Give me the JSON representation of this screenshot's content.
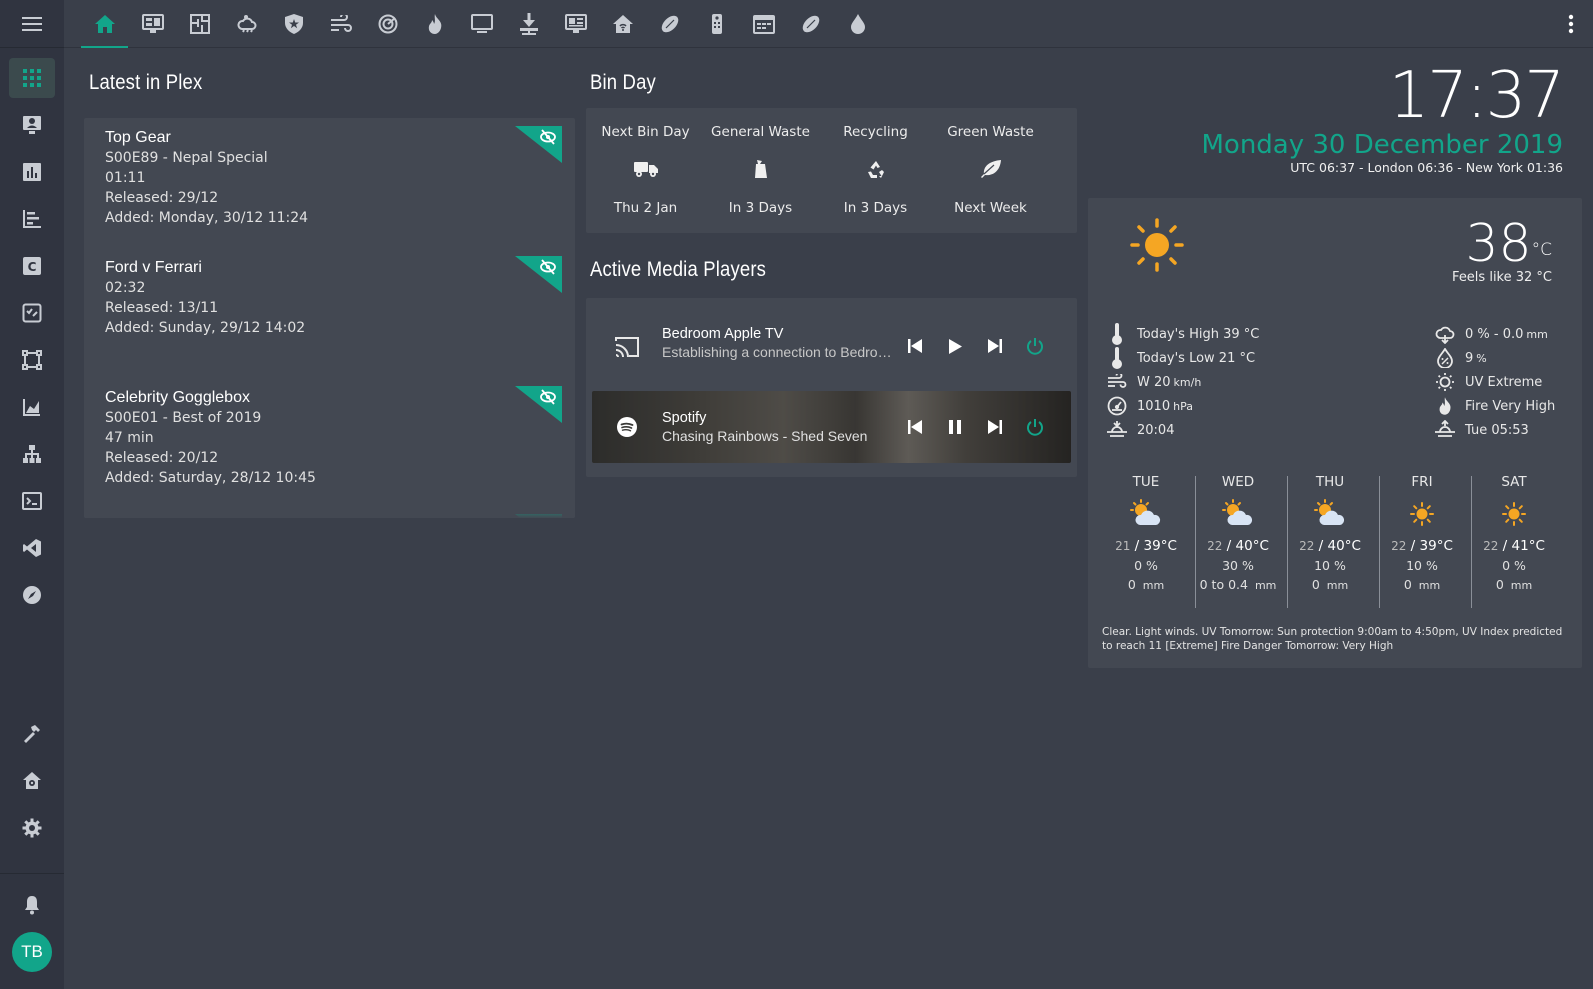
{
  "colors": {
    "accent": "#12a58a",
    "background": "#3a3f4a",
    "card": "#434852",
    "sidebar": "#303440",
    "sun": "#f5a623"
  },
  "sidebar": {
    "menu_icon": "hamburger-menu-icon",
    "items": [
      "grid-icon",
      "contact-card-icon",
      "bar-chart-icon",
      "gantt-icon",
      "c-box-icon",
      "checklist-icon",
      "vector-square-icon",
      "area-chart-icon",
      "network-icon",
      "terminal-icon",
      "vscode-icon",
      "compass-icon"
    ],
    "bottom_items": [
      "hammer-icon",
      "home-gear-icon",
      "settings-icon"
    ],
    "notification_icon": "bell-icon",
    "avatar_initials": "TB"
  },
  "topbar": {
    "tabs": [
      "home",
      "monitor-dashboard",
      "floor-plan",
      "weather-cloud",
      "shield",
      "wind",
      "radar",
      "fire",
      "television",
      "download",
      "newspaper",
      "home-automation",
      "rugby-ball",
      "remote",
      "calendar",
      "rugby-ball-2",
      "water-drop"
    ],
    "active_tab": "home",
    "more_icon": "dots-vertical-icon"
  },
  "plex": {
    "header": "Latest in Plex",
    "items": [
      {
        "title": "Top Gear",
        "lines": [
          "S00E89 - Nepal Special",
          "01:11",
          "Released: 29/12",
          "Added: Monday, 30/12 11:24"
        ]
      },
      {
        "title": "Ford v Ferrari",
        "lines": [
          "02:32",
          "Released: 13/11",
          "Added: Sunday, 29/12 14:02"
        ]
      },
      {
        "title": "Celebrity Gogglebox",
        "lines": [
          "S00E01 - Best of 2019",
          "47 min",
          "Released: 20/12",
          "Added: Saturday, 28/12 10:45"
        ]
      }
    ]
  },
  "bin_day": {
    "header": "Bin Day",
    "columns": [
      {
        "label": "Next Bin Day",
        "icon": "truck-icon",
        "value": "Thu 2 Jan"
      },
      {
        "label": "General Waste",
        "icon": "trash-bag-icon",
        "value": "In 3 Days"
      },
      {
        "label": "Recycling",
        "icon": "recycle-icon",
        "value": "In 3 Days"
      },
      {
        "label": "Green Waste",
        "icon": "leaf-icon",
        "value": "Next Week"
      }
    ]
  },
  "media": {
    "header": "Active Media Players",
    "players": [
      {
        "name": "Bedroom Apple TV",
        "status": "Establishing a connection to Bedroom Apple TV",
        "icon": "cast-icon",
        "state": "paused"
      },
      {
        "name": "Spotify",
        "status": "Chasing Rainbows - Shed Seven",
        "icon": "spotify-icon",
        "state": "playing"
      }
    ]
  },
  "clock": {
    "time": "17:37",
    "date": "Monday 30 December 2019",
    "timezones": "UTC 06:37 - London 06:36 - New York 01:36"
  },
  "weather": {
    "current_icon": "sunny-icon",
    "temperature": "38",
    "temperature_unit": "°C",
    "feels_like": "Feels like 32 °C",
    "left": [
      {
        "icon": "thermometer-high-icon",
        "text": "Today's High 39 °C",
        "unit": ""
      },
      {
        "icon": "thermometer-low-icon",
        "text": "Today's Low 21 °C",
        "unit": ""
      },
      {
        "icon": "wind-icon",
        "text": "W 20",
        "unit": "km/h"
      },
      {
        "icon": "gauge-icon",
        "text": "1010",
        "unit": "hPa"
      },
      {
        "icon": "sunset-icon",
        "text": "20:04",
        "unit": ""
      }
    ],
    "right": [
      {
        "icon": "rain-cloud-icon",
        "text": "0 % - 0.0",
        "unit": "mm"
      },
      {
        "icon": "humidity-icon",
        "text": "9",
        "unit": "%"
      },
      {
        "icon": "uv-icon",
        "text": "UV Extreme",
        "unit": ""
      },
      {
        "icon": "fire-icon",
        "text": "Fire Very High",
        "unit": ""
      },
      {
        "icon": "sunrise-icon",
        "text": "Tue 05:53",
        "unit": ""
      }
    ],
    "forecast": [
      {
        "day": "TUE",
        "icon": "partly-cloudy-icon",
        "low": "21",
        "high": "39°C",
        "rain_chance": "0 %",
        "rain_amount": "0",
        "rain_unit": "mm"
      },
      {
        "day": "WED",
        "icon": "partly-cloudy-icon",
        "low": "22",
        "high": "40°C",
        "rain_chance": "30 %",
        "rain_amount": "0 to 0.4",
        "rain_unit": "mm"
      },
      {
        "day": "THU",
        "icon": "partly-cloudy-icon",
        "low": "22",
        "high": "40°C",
        "rain_chance": "10 %",
        "rain_amount": "0",
        "rain_unit": "mm"
      },
      {
        "day": "FRI",
        "icon": "sunny-icon",
        "low": "22",
        "high": "39°C",
        "rain_chance": "10 %",
        "rain_amount": "0",
        "rain_unit": "mm"
      },
      {
        "day": "SAT",
        "icon": "sunny-icon",
        "low": "22",
        "high": "41°C",
        "rain_chance": "0 %",
        "rain_amount": "0",
        "rain_unit": "mm"
      }
    ],
    "description": "Clear. Light winds. UV Tomorrow: Sun protection 9:00am to 4:50pm, UV Index predicted to reach 11 [Extreme] Fire Danger Tomorrow: Very High"
  }
}
